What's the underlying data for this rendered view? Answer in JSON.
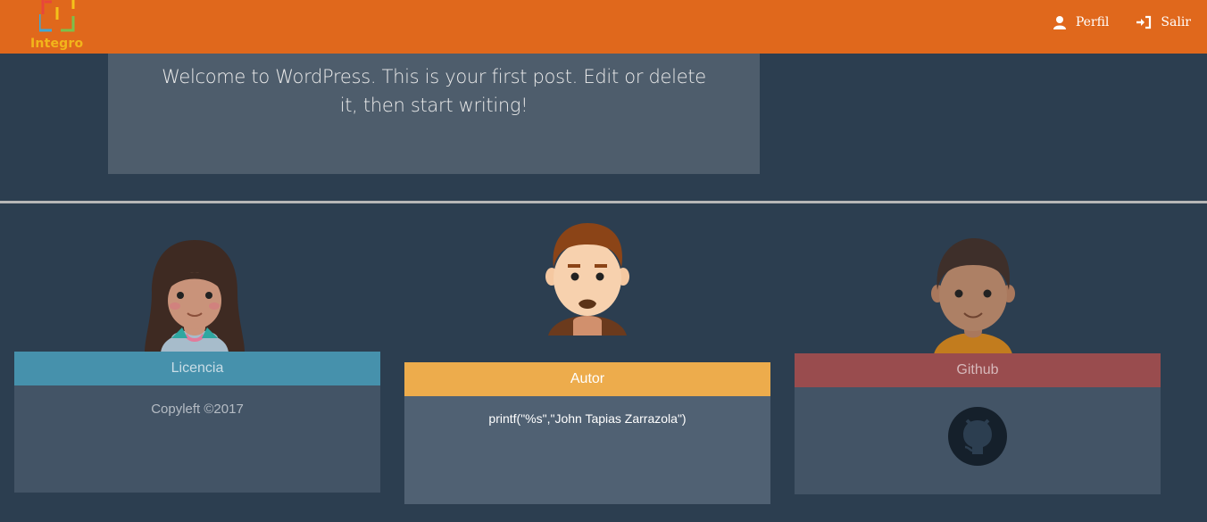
{
  "header": {
    "logo_text": "Integro",
    "nav": {
      "profile_label": "Perfil",
      "logout_label": "Salir"
    },
    "colors": {
      "bar": "#e0681c",
      "logo": "#f2b51b"
    }
  },
  "post": {
    "excerpt": "Welcome to WordPress. This is your first post. Edit or delete it, then start writing!"
  },
  "footer": {
    "license": {
      "title": "Licencia",
      "text": "Copyleft ©2017",
      "color": "#4691ac"
    },
    "author": {
      "title": "Autor",
      "text": "printf(\"%s\",\"John Tapias Zarrazola\")",
      "color": "#edac4c"
    },
    "github": {
      "title": "Github",
      "icon": "github-icon",
      "color": "#994c4e"
    }
  }
}
